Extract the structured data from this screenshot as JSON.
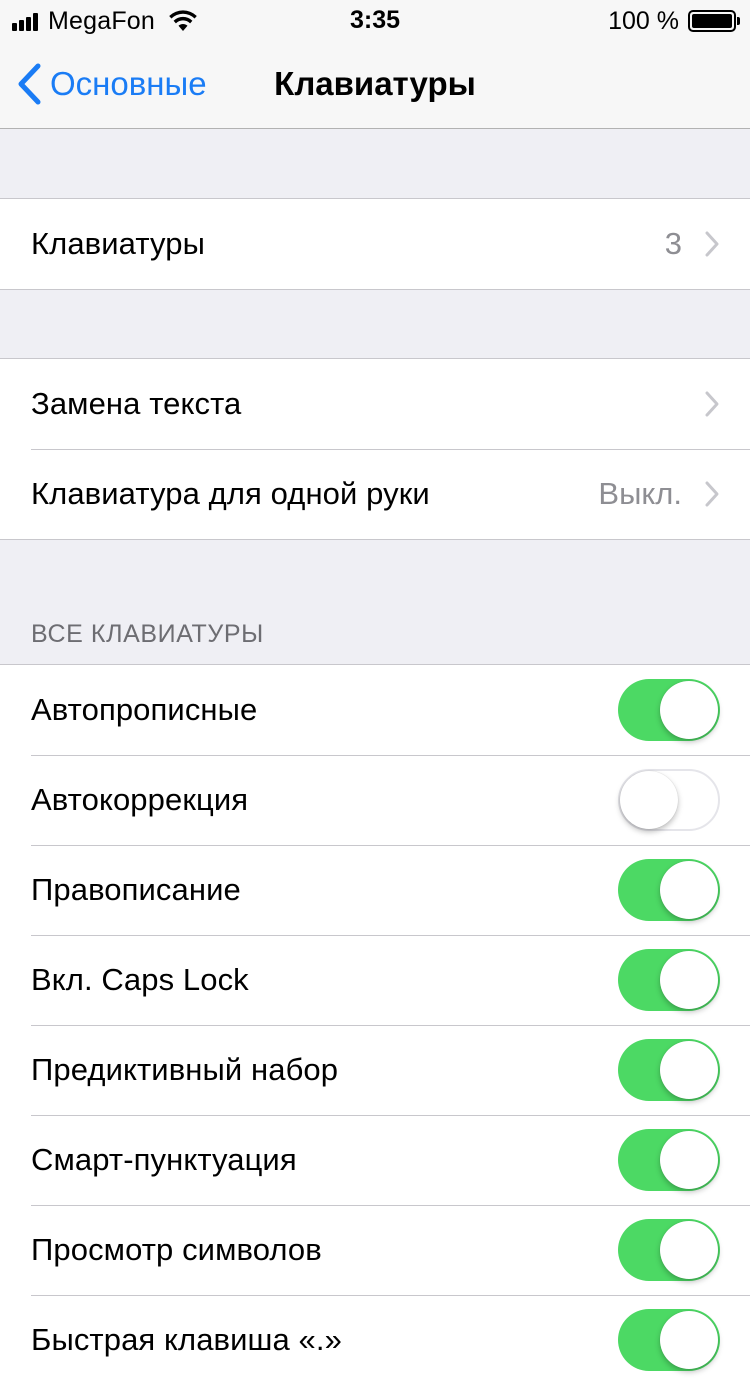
{
  "status_bar": {
    "carrier": "MegaFon",
    "time": "3:35",
    "battery_percent": "100 %",
    "signal_bars": 4,
    "signal_bars_total": 4
  },
  "nav": {
    "back_label": "Основные",
    "title": "Клавиатуры"
  },
  "keyboards_row": {
    "label": "Клавиатуры",
    "value": "3"
  },
  "text_group": {
    "text_replacement_label": "Замена текста",
    "one_handed_label": "Клавиатура для одной руки",
    "one_handed_value": "Выкл."
  },
  "all_keyboards": {
    "header": "ВСЕ КЛАВИАТУРЫ",
    "items": [
      {
        "label": "Автопрописные",
        "on": true
      },
      {
        "label": "Автокоррекция",
        "on": false
      },
      {
        "label": "Правописание",
        "on": true
      },
      {
        "label": "Вкл. Caps Lock",
        "on": true
      },
      {
        "label": "Предиктивный набор",
        "on": true
      },
      {
        "label": "Смарт-пунктуация",
        "on": true
      },
      {
        "label": "Просмотр символов",
        "on": true
      },
      {
        "label": "Быстрая клавиша «.»",
        "on": true
      }
    ]
  },
  "colors": {
    "accent": "#1a7cf5",
    "toggle_on": "#4cd964",
    "background": "#efeff4"
  }
}
